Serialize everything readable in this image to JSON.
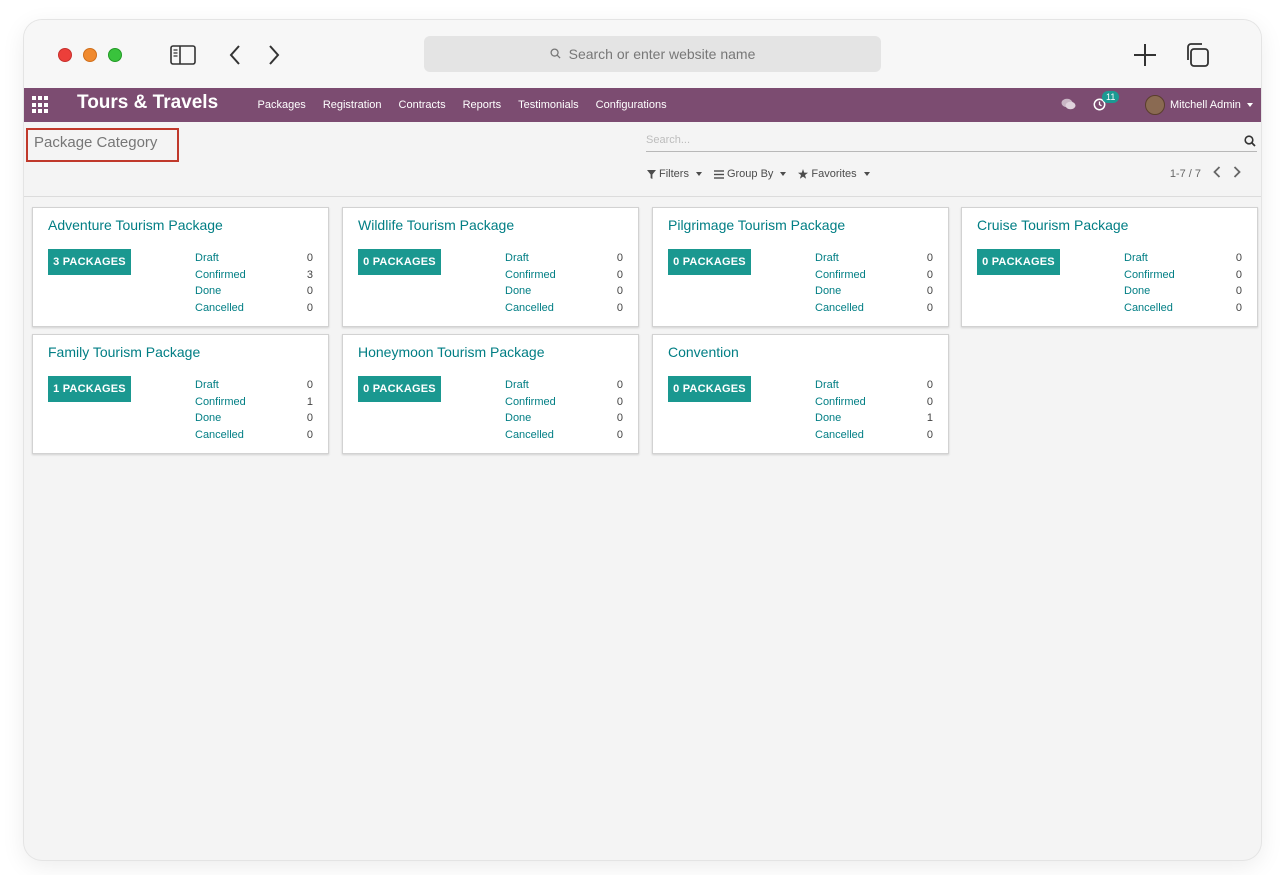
{
  "browser": {
    "address_placeholder": "Search or enter website name"
  },
  "navbar": {
    "brand": "Tours & Travels",
    "menu": [
      "Packages",
      "Registration",
      "Contracts",
      "Reports",
      "Testimonials",
      "Configurations"
    ],
    "activity_count": "11",
    "user": "Mitchell Admin",
    "color": "#7c4c71"
  },
  "control": {
    "title": "Package Category",
    "search_placeholder": "Search...",
    "filters_label": "Filters",
    "groupby_label": "Group By",
    "favorites_label": "Favorites",
    "pager": "1-7 / 7"
  },
  "accent": "#1a9890",
  "cards": [
    {
      "title": "Adventure Tourism Package",
      "button": "3 PACKAGES",
      "stats": [
        {
          "label": "Draft",
          "value": "0"
        },
        {
          "label": "Confirmed",
          "value": "3"
        },
        {
          "label": "Done",
          "value": "0"
        },
        {
          "label": "Cancelled",
          "value": "0"
        }
      ]
    },
    {
      "title": "Wildlife Tourism Package",
      "button": "0 PACKAGES",
      "stats": [
        {
          "label": "Draft",
          "value": "0"
        },
        {
          "label": "Confirmed",
          "value": "0"
        },
        {
          "label": "Done",
          "value": "0"
        },
        {
          "label": "Cancelled",
          "value": "0"
        }
      ]
    },
    {
      "title": "Pilgrimage Tourism Package",
      "button": "0 PACKAGES",
      "stats": [
        {
          "label": "Draft",
          "value": "0"
        },
        {
          "label": "Confirmed",
          "value": "0"
        },
        {
          "label": "Done",
          "value": "0"
        },
        {
          "label": "Cancelled",
          "value": "0"
        }
      ]
    },
    {
      "title": "Cruise Tourism Package",
      "button": "0 PACKAGES",
      "stats": [
        {
          "label": "Draft",
          "value": "0"
        },
        {
          "label": "Confirmed",
          "value": "0"
        },
        {
          "label": "Done",
          "value": "0"
        },
        {
          "label": "Cancelled",
          "value": "0"
        }
      ]
    },
    {
      "title": "Family Tourism Package",
      "button": "1 PACKAGES",
      "stats": [
        {
          "label": "Draft",
          "value": "0"
        },
        {
          "label": "Confirmed",
          "value": "1"
        },
        {
          "label": "Done",
          "value": "0"
        },
        {
          "label": "Cancelled",
          "value": "0"
        }
      ]
    },
    {
      "title": "Honeymoon Tourism Package",
      "button": "0 PACKAGES",
      "stats": [
        {
          "label": "Draft",
          "value": "0"
        },
        {
          "label": "Confirmed",
          "value": "0"
        },
        {
          "label": "Done",
          "value": "0"
        },
        {
          "label": "Cancelled",
          "value": "0"
        }
      ]
    },
    {
      "title": "Convention",
      "button": "0 PACKAGES",
      "stats": [
        {
          "label": "Draft",
          "value": "0"
        },
        {
          "label": "Confirmed",
          "value": "0"
        },
        {
          "label": "Done",
          "value": "1"
        },
        {
          "label": "Cancelled",
          "value": "0"
        }
      ]
    }
  ]
}
